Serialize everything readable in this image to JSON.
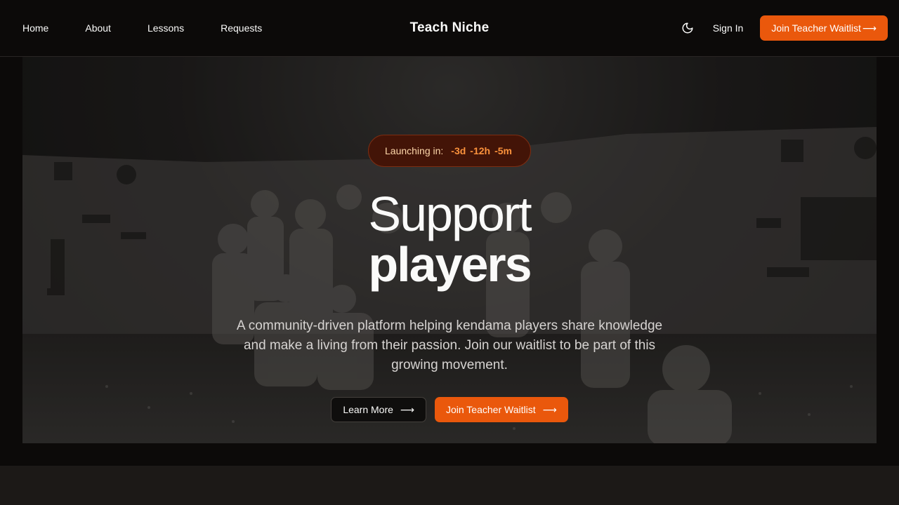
{
  "nav": {
    "links": [
      "Home",
      "About",
      "Lessons",
      "Requests"
    ],
    "brand": "Teach Niche",
    "theme_icon": "moon-icon",
    "sign_in": "Sign In",
    "cta": "Join Teacher Waitlist",
    "cta_arrow": "⟶"
  },
  "hero": {
    "countdown_label": "Launching in:",
    "countdown": {
      "days": "-3d",
      "hours": "-12h",
      "minutes": "-5m"
    },
    "headline_line1": "Support",
    "headline_line2": "players",
    "subtitle": "A community-driven platform helping kendama players share knowledge and make a living from their passion. Join our waitlist to be part of this growing movement.",
    "learn_more": "Learn More",
    "cta": "Join Teacher Waitlist",
    "arrow": "⟶"
  },
  "colors": {
    "accent": "#ea580c",
    "background": "#0c0a09",
    "countdown_bg": "#431407"
  }
}
